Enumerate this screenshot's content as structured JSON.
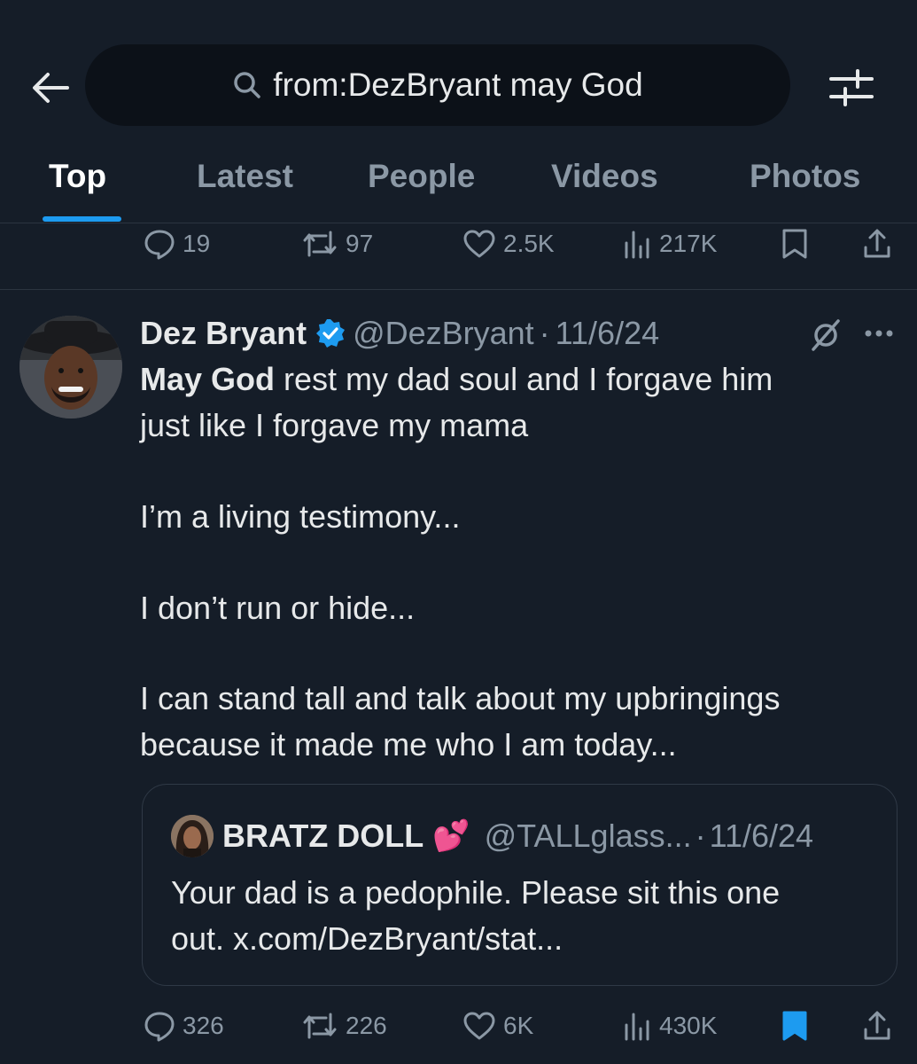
{
  "search": {
    "query": "from:DezBryant may God"
  },
  "tabs": [
    "Top",
    "Latest",
    "People",
    "Videos",
    "Photos"
  ],
  "prev_tweet_actions": {
    "replies": "19",
    "reposts": "97",
    "likes": "2.5K",
    "views": "217K"
  },
  "tweet": {
    "author_name": "Dez Bryant",
    "handle": "@DezBryant",
    "separator": "·",
    "date": "11/6/24",
    "text_line1_bold": "May God",
    "text_line1_rest": " rest my dad soul and I forgave him",
    "text_line2": "just like I forgave my mama",
    "text_line3": "I’m a living testimony...",
    "text_line4": "I don’t run or hide...",
    "text_line5": "I can stand tall and talk about my upbringings",
    "text_line6": "because it made me who I am today..."
  },
  "quote": {
    "author_name": "BRATZ DOLL",
    "emoji": "💕",
    "handle": "@TALLglass...",
    "separator": "·",
    "date": "11/6/24",
    "text_line1": "Your dad is a pedophile. Please sit this one",
    "text_line2": "out. x.com/DezBryant/stat..."
  },
  "tweet_actions": {
    "replies": "326",
    "reposts": "226",
    "likes": "6K",
    "views": "430K",
    "bookmarked": true
  },
  "colors": {
    "accent": "#1d9bf0",
    "background": "#151d28",
    "muted": "#8b98a5"
  }
}
